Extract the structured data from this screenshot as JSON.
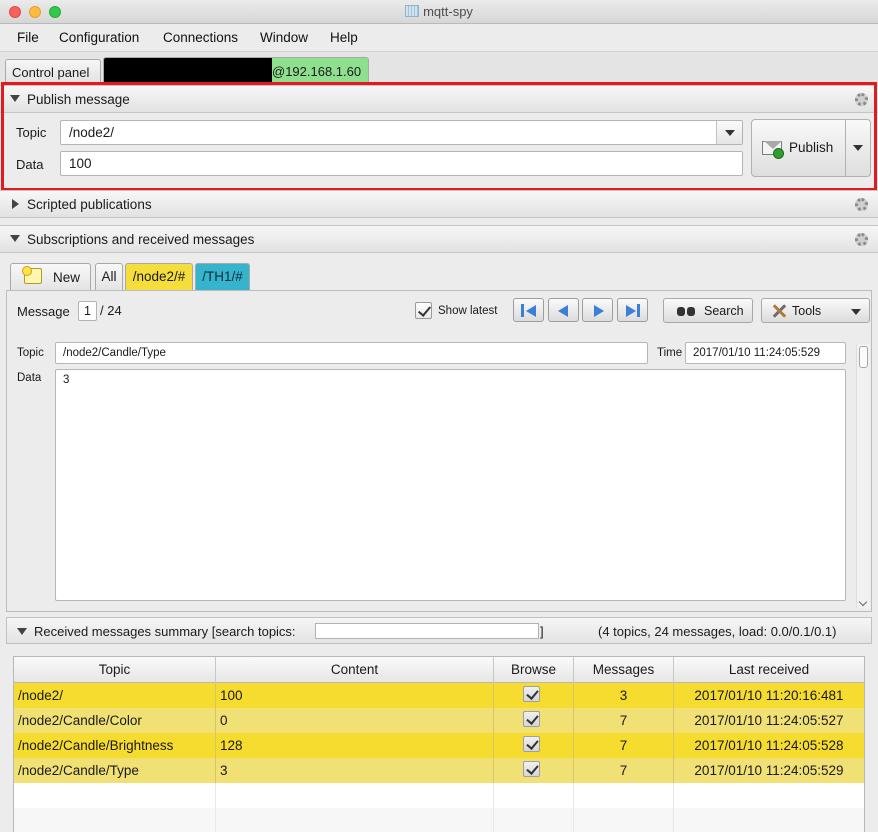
{
  "window": {
    "title": "mqtt-spy"
  },
  "menu": [
    "File",
    "Configuration",
    "Connections",
    "Window",
    "Help"
  ],
  "connection_tabs": {
    "control_panel": "Control panel",
    "connection_suffix": "@192.168.1.60",
    "connection_color": "#8ee08e"
  },
  "publish": {
    "title": "Publish message",
    "topic_label": "Topic",
    "topic_value": "/node2/",
    "data_label": "Data",
    "data_value": "100",
    "publish_label": "Publish"
  },
  "scripted": {
    "title": "Scripted publications"
  },
  "subscriptions": {
    "title": "Subscriptions and received messages",
    "tabs": [
      {
        "label": "New",
        "color": ""
      },
      {
        "label": "All",
        "color": ""
      },
      {
        "label": "/node2/#",
        "color": "#f5de3b"
      },
      {
        "label": "/TH1/#",
        "color": "#36b3cd"
      }
    ],
    "message_label": "Message",
    "message_index": "1",
    "message_total": "/ 24",
    "show_latest_label": "Show latest",
    "show_latest_checked": true,
    "search_label": "Search",
    "tools_label": "Tools",
    "topic_label": "Topic",
    "topic_value": "/node2/Candle/Type",
    "time_label": "Time",
    "time_value": "2017/01/10 11:24:05:529",
    "data_label": "Data",
    "data_value": "3"
  },
  "summary": {
    "title": "Received messages summary [search topics:",
    "title_close": "]",
    "stats": "(4 topics, 24 messages, load: 0.0/0.1/0.1)",
    "columns": [
      "Topic",
      "Content",
      "Browse",
      "Messages",
      "Last received"
    ],
    "rows": [
      {
        "topic": "/node2/",
        "content": "100",
        "browse": true,
        "messages": "3",
        "last": "2017/01/10 11:20:16:481"
      },
      {
        "topic": "/node2/Candle/Color",
        "content": "0",
        "browse": true,
        "messages": "7",
        "last": "2017/01/10 11:24:05:527"
      },
      {
        "topic": "/node2/Candle/Brightness",
        "content": "128",
        "browse": true,
        "messages": "7",
        "last": "2017/01/10 11:24:05:528"
      },
      {
        "topic": "/node2/Candle/Type",
        "content": "3",
        "browse": true,
        "messages": "7",
        "last": "2017/01/10 11:24:05:529"
      }
    ],
    "row_colors": [
      "#f5dc2e",
      "#f1e073"
    ]
  }
}
